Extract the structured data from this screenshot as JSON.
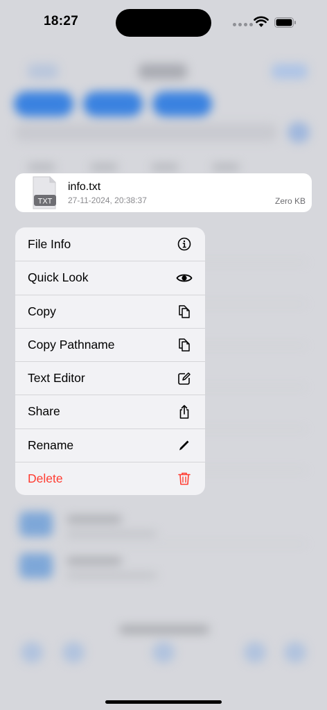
{
  "status_bar": {
    "time": "18:27"
  },
  "preview": {
    "icon_label": "TXT",
    "file_name": "info.txt",
    "modified": "27-11-2024, 20:38:37",
    "size": "Zero KB"
  },
  "menu": {
    "items": [
      {
        "label": "File Info",
        "icon": "info-circle-icon"
      },
      {
        "label": "Quick Look",
        "icon": "eye-icon"
      },
      {
        "label": "Copy",
        "icon": "documents-copy-icon"
      },
      {
        "label": "Copy Pathname",
        "icon": "documents-copy-icon"
      },
      {
        "label": "Text Editor",
        "icon": "square-pencil-icon"
      },
      {
        "label": "Share",
        "icon": "share-icon"
      },
      {
        "label": "Rename",
        "icon": "pencil-icon"
      },
      {
        "label": "Delete",
        "icon": "trash-icon",
        "destructive": true
      }
    ]
  },
  "colors": {
    "destructive": "#ff3b30",
    "accent": "#3a82e0"
  }
}
